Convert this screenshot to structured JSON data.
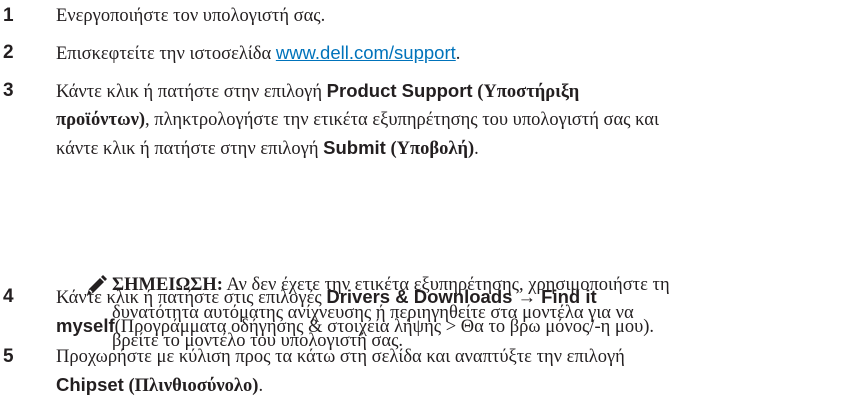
{
  "steps": [
    {
      "num": "1",
      "text": "Ενεργοποιήστε τον υπολογιστή σας."
    },
    {
      "num": "2",
      "before": "Επισκεφτείτε την ιστοσελίδα ",
      "link": "www.dell.com/support",
      "after": "."
    },
    {
      "num": "3",
      "l1_a": "Κάντε κλικ ή πατήστε στην επιλογή ",
      "l1_b": "Product Support",
      "l1_c": " (Υποστήριξη",
      "l2_a": "προϊόντων)",
      "l2_b": ", πληκτρολογήστε την ετικέτα εξυπηρέτησης του υπολογιστή σας και",
      "l3_a": "κάντε κλικ ή πατήστε στην επιλογή ",
      "l3_b": "Submit",
      "l3_c": " (Υποβολή)",
      "l3_d": "."
    },
    {
      "num": "4",
      "l1_a": "Κάντε κλικ ή πατήστε στις επιλογές ",
      "l1_b": "Drivers & Downloads → Find it",
      "l2_a": "myself",
      "l2_b": "(Προγράμματα οδήγησης & στοιχεία λήψης > Θα το βρω μόνος/-η μου)."
    },
    {
      "num": "5",
      "l1": "Προχωρήστε με κύλιση προς τα κάτω στη σελίδα και αναπτύξτε την επιλογή",
      "l2_a": "Chipset",
      "l2_b": " (Πλινθιοσύνολο)",
      "l2_c": "."
    }
  ],
  "note": {
    "icon": "pencil-note-icon",
    "label": "ΣΗΜΕΙΩΣΗ:",
    "l1": " Αν δεν έχετε την ετικέτα εξυπηρέτησης, χρησιμοποιήστε τη",
    "l2": "δυνατότητα αυτόματης ανίχνευσης ή περιηγηθείτε στα μοντέλα για να",
    "l3": "βρείτε το μοντέλο του υπολογιστή σας."
  }
}
